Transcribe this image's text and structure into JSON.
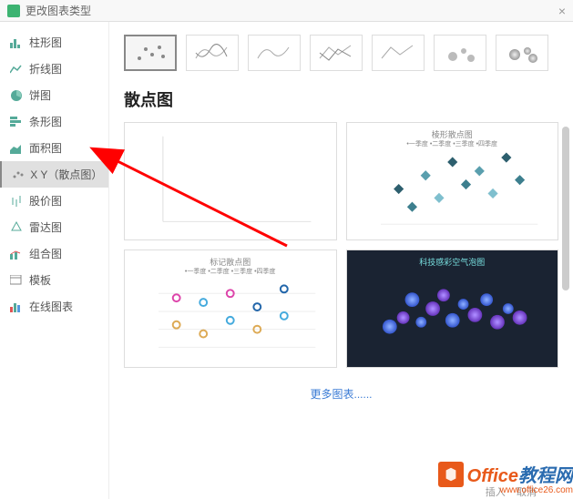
{
  "titlebar": {
    "title": "更改图表类型",
    "close": "×"
  },
  "sidebar": {
    "items": [
      {
        "label": "柱形图",
        "name": "sidebar-item-column"
      },
      {
        "label": "折线图",
        "name": "sidebar-item-line"
      },
      {
        "label": "饼图",
        "name": "sidebar-item-pie"
      },
      {
        "label": "条形图",
        "name": "sidebar-item-bar"
      },
      {
        "label": "面积图",
        "name": "sidebar-item-area"
      },
      {
        "label": "X Y（散点图）",
        "name": "sidebar-item-scatter"
      },
      {
        "label": "股价图",
        "name": "sidebar-item-stock"
      },
      {
        "label": "雷达图",
        "name": "sidebar-item-radar"
      },
      {
        "label": "组合图",
        "name": "sidebar-item-combo"
      },
      {
        "label": "模板",
        "name": "sidebar-item-template"
      },
      {
        "label": "在线图表",
        "name": "sidebar-item-online"
      }
    ]
  },
  "section": {
    "title": "散点图"
  },
  "previews": {
    "card2_title": "棱形散点图",
    "card2_legend": "•一季度   •二季度   •三季度   •四季度",
    "card3_title": "标记散点图",
    "card3_legend": "•一季度   •二季度   •三季度   •四季度",
    "card4_title": "科技感彩空气泡图"
  },
  "more_link": "更多图表......",
  "footer": {
    "insert": "插入",
    "cancel": "取消"
  },
  "watermark": {
    "text1": "Office",
    "text2": "教程网",
    "url": "www.office26.com"
  }
}
